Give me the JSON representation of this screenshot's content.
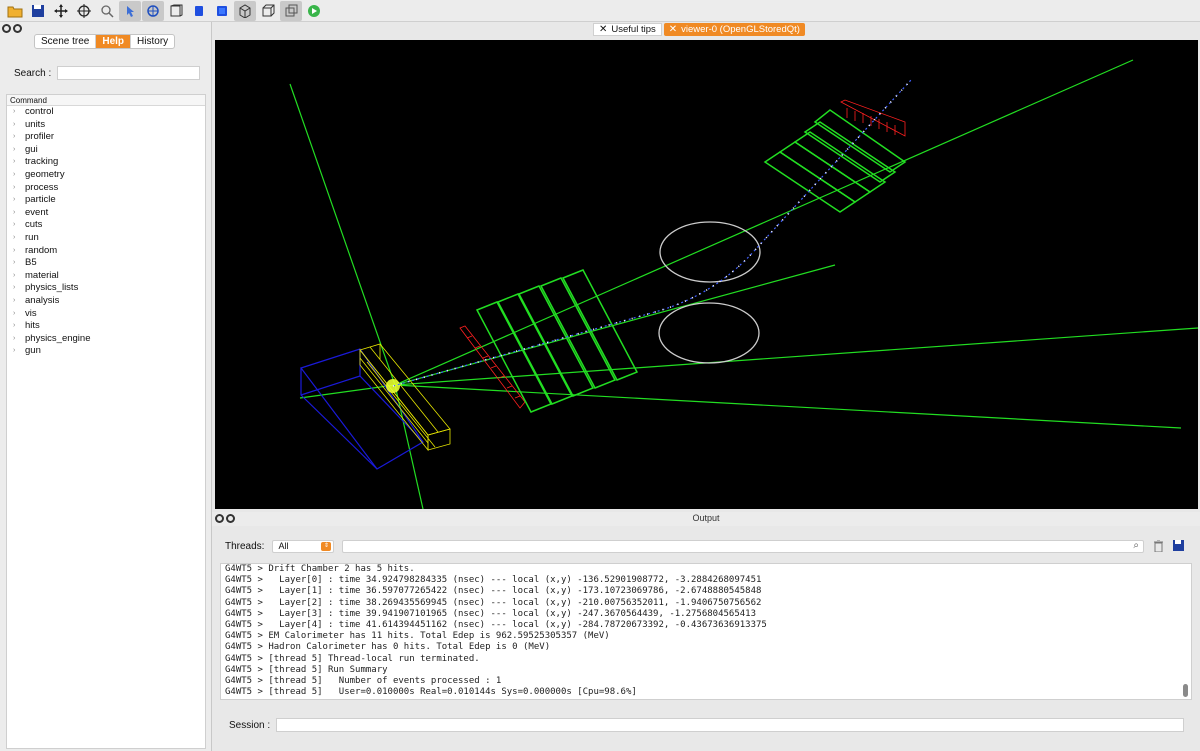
{
  "toolbar": {
    "icons": [
      "open-folder-icon",
      "save-icon",
      "move-icon",
      "crosshair-icon",
      "zoom-icon",
      "pick-icon",
      "rotate-icon",
      "perspective-icon",
      "surface-style-icon",
      "solid-style-icon",
      "hidden-line-icon",
      "wireframe-icon",
      "cull-icon",
      "run-icon"
    ]
  },
  "left_dock": {
    "tabs": [
      "Scene tree",
      "Help",
      "History"
    ],
    "selected_tab": "Help",
    "search_label": "Search :",
    "search_value": "",
    "tree_header": "Command",
    "commands": [
      "control",
      "units",
      "profiler",
      "gui",
      "tracking",
      "geometry",
      "process",
      "particle",
      "event",
      "cuts",
      "run",
      "random",
      "B5",
      "material",
      "physics_lists",
      "analysis",
      "vis",
      "hits",
      "physics_engine",
      "gun"
    ]
  },
  "viewer_tabs": [
    {
      "label": "Useful tips",
      "active": false
    },
    {
      "label": "viewer-0 (OpenGLStoredQt)",
      "active": true
    }
  ],
  "output": {
    "title": "Output",
    "threads_label": "Threads:",
    "threads_value": "All",
    "search_value": "",
    "lines": [
      "G4WT5 > Drift Chamber 2 has 5 hits.",
      "G4WT5 >   Layer[0] : time 34.924798284335 (nsec) --- local (x,y) -136.52901908772, -3.2884268097451",
      "G4WT5 >   Layer[1] : time 36.597077265422 (nsec) --- local (x,y) -173.10723069786, -2.6748880545848",
      "G4WT5 >   Layer[2] : time 38.269435569945 (nsec) --- local (x,y) -210.00756352011, -1.9406750756562",
      "G4WT5 >   Layer[3] : time 39.941907101965 (nsec) --- local (x,y) -247.3670564439, -1.2756804565413",
      "G4WT5 >   Layer[4] : time 41.614394451162 (nsec) --- local (x,y) -284.78720673392, -0.43673636913375",
      "G4WT5 > EM Calorimeter has 11 hits. Total Edep is 962.59525305357 (MeV)",
      "G4WT5 > Hadron Calorimeter has 0 hits. Total Edep is 0 (MeV)",
      "G4WT5 > [thread 5] Thread-local run terminated.",
      "G4WT5 > [thread 5] Run Summary",
      "G4WT5 > [thread 5]   Number of events processed : 1",
      "G4WT5 > [thread 5]   User=0.010000s Real=0.010144s Sys=0.000000s [Cpu=98.6%]"
    ],
    "session_label": "Session :",
    "session_value": ""
  },
  "colors": {
    "accent": "#f08a24",
    "viewer_bg": "#000000",
    "chamber": "#22dd22",
    "calorimeter": "#e8e800",
    "hodoscope": "#ff2020",
    "magnet": "#cccccc",
    "target_box": "#1a1ad8"
  }
}
